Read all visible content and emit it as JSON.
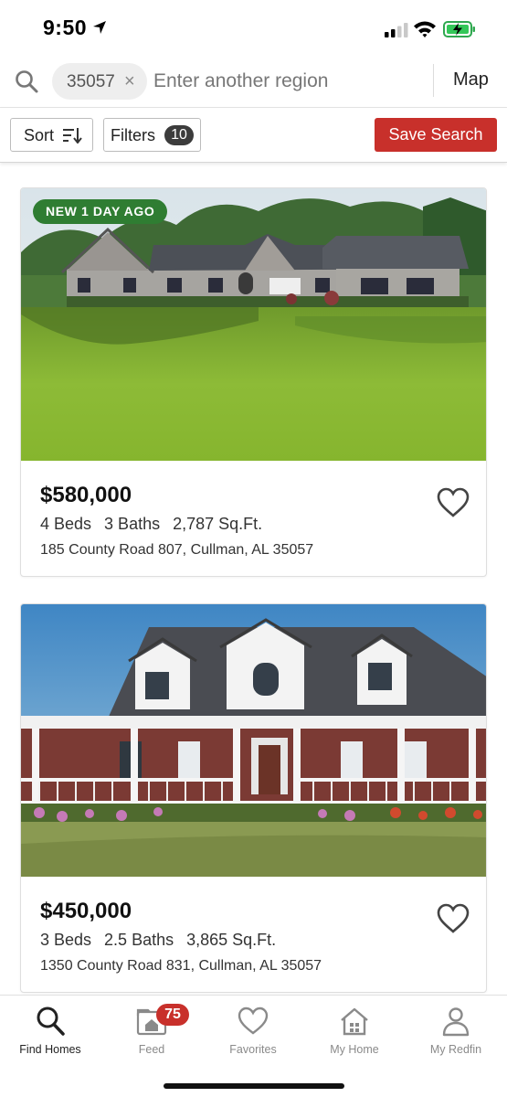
{
  "status_bar": {
    "time": "9:50"
  },
  "search": {
    "region_chip": "35057",
    "placeholder": "Enter another region",
    "map_label": "Map"
  },
  "filter_bar": {
    "sort_label": "Sort",
    "filters_label": "Filters",
    "filters_count": "10",
    "save_search_label": "Save Search"
  },
  "listings": [
    {
      "badge": "NEW  1 DAY AGO",
      "price": "$580,000",
      "beds": "4 Beds",
      "baths": "3 Baths",
      "sqft": "2,787 Sq.Ft.",
      "address": "185 County Road 807, Cullman, AL 35057"
    },
    {
      "price": "$450,000",
      "beds": "3 Beds",
      "baths": "2.5 Baths",
      "sqft": "3,865 Sq.Ft.",
      "address": "1350 County Road 831, Cullman, AL 35057"
    }
  ],
  "tabs": [
    {
      "label": "Find Homes",
      "icon": "search-icon",
      "active": true
    },
    {
      "label": "Feed",
      "icon": "feed-icon",
      "badge": "75"
    },
    {
      "label": "Favorites",
      "icon": "heart-icon"
    },
    {
      "label": "My Home",
      "icon": "house-icon"
    },
    {
      "label": "My Redfin",
      "icon": "person-icon"
    }
  ],
  "colors": {
    "brand_red": "#c8302b",
    "new_badge_green": "#2f7d32",
    "filter_count_bg": "#3c3c3c"
  }
}
